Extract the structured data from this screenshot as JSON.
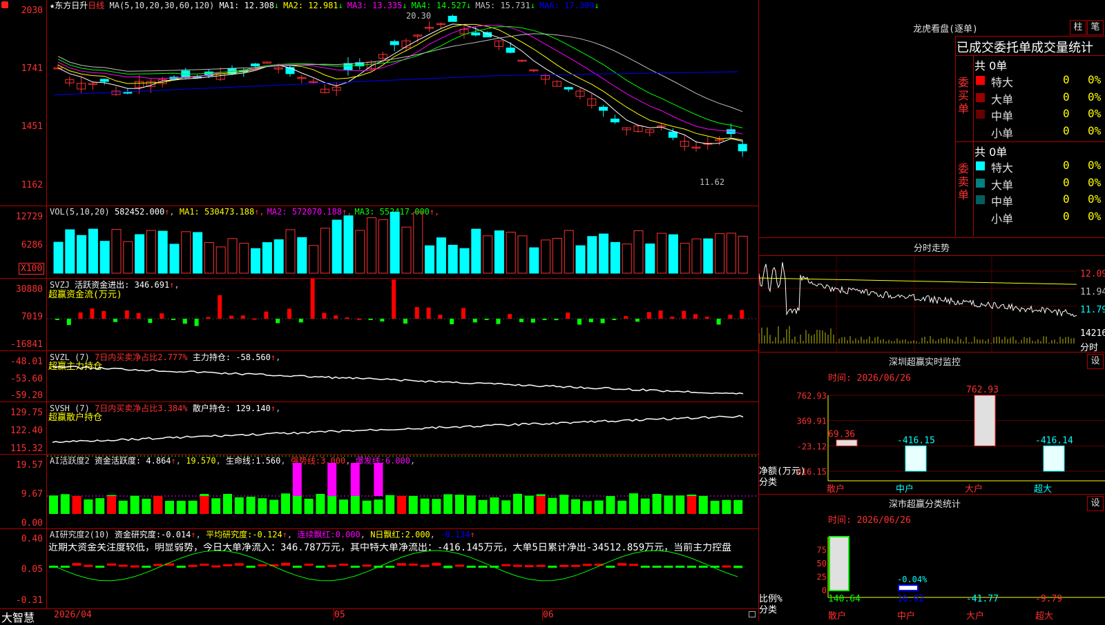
{
  "app_name": "大智慧",
  "chart": {
    "stock_name": "东方日升",
    "period": "日线",
    "ma_params": "MA(5,10,20,30,60,120)",
    "ma_values": [
      {
        "label": "MA1:",
        "value": "12.308",
        "arrow": "↓",
        "color": "#ffffff"
      },
      {
        "label": "MA2:",
        "value": "12.981",
        "arrow": "↓",
        "color": "#ffff00"
      },
      {
        "label": "MA3:",
        "value": "13.335",
        "arrow": "↓",
        "color": "#ff00ff"
      },
      {
        "label": "MA4:",
        "value": "14.527",
        "arrow": "↓",
        "color": "#00ff00"
      },
      {
        "label": "MA5:",
        "value": "15.731",
        "arrow": "↓",
        "color": "#c0c0c0"
      },
      {
        "label": "MA6:",
        "value": "17.309",
        "arrow": "↓",
        "color": "#0000ff"
      }
    ],
    "y_ticks": [
      "2030",
      "1741",
      "1451",
      "1162"
    ],
    "high_label": "20.30",
    "low_label": "11.62",
    "date_labels": [
      "2026/04",
      "05",
      "06"
    ]
  },
  "vol": {
    "title": "VOL(5,10,20)",
    "value": "582452.000",
    "arrow": "↑",
    "ma": [
      {
        "label": "MA1:",
        "value": "530473.188",
        "arrow": "↑",
        "color": "#ffff00"
      },
      {
        "label": "MA2:",
        "value": "572070.188",
        "arrow": "↑",
        "color": "#ff00ff"
      },
      {
        "label": "MA3:",
        "value": "552417.000",
        "arrow": "↑",
        "color": "#00ff00"
      }
    ],
    "y_ticks": [
      "12729",
      "6286"
    ],
    "unit": "X100"
  },
  "svzj": {
    "title": "SVZJ",
    "label": "活跃资金进出:",
    "value": "346.691",
    "arrow": "↑",
    "subtitle": "超赢资金流(万元)",
    "y_ticks": [
      "30880",
      "7019",
      "-16841"
    ]
  },
  "svzl": {
    "title": "SVZL (7)",
    "text1": "7日内买卖净占比2.777%",
    "text2": "主力持仓:",
    "value": "-58.560",
    "arrow": "↑",
    "subtitle": "超赢主力持仓",
    "y_ticks": [
      "-48.01",
      "-53.60",
      "-59.20"
    ]
  },
  "svsh": {
    "title": "SVSH (7)",
    "text1": "7日内买卖净占比3.384%",
    "text2": "散户持仓:",
    "value": "129.140",
    "arrow": "↑",
    "subtitle": "超赢散户持仓",
    "y_ticks": [
      "129.75",
      "122.40",
      "115.32"
    ]
  },
  "ai_activity": {
    "title": "AI活跃度2",
    "label1": "资金活跃度:",
    "value1": "4.864",
    "value2": "19.570",
    "label3": "生命线:",
    "value3": "1.560",
    "label4": "强势线:",
    "value4": "3.000",
    "label5": "爆发线:",
    "value5": "6.000",
    "y_ticks": [
      "19.57",
      "9.67",
      "0.00"
    ]
  },
  "ai_research": {
    "title": "AI研究度2(10)",
    "label1": "资金研究度:",
    "value1": "-0.014",
    "label2": "平均研究度:",
    "value2": "-0.124",
    "label3": "连续飘红:",
    "value3": "0.000",
    "label4": "N日飘红:",
    "value4": "2.000",
    "value5": "-0.134",
    "comment": "近期大资金关注度较低，明显弱势，今日大单净流入：346.787万元，其中特大单净流出：-416.145万元，大单5日累计净出-34512.859万元，当前主力控盘",
    "y_ticks": [
      "0.40",
      "0.05",
      "-0.31"
    ]
  },
  "longhu": {
    "title": "龙虎看盘(逐单)",
    "btn1": "柱",
    "btn2": "笔",
    "subtitle": "已成交委托单成交量统计",
    "buy_label": "委买单",
    "sell_label": "委卖单",
    "buy_total": "共 0单",
    "sell_total": "共 0单",
    "buy_rows": [
      {
        "name": "特大",
        "count": "0",
        "pct": "0%",
        "color": "#ff0000"
      },
      {
        "name": "大单",
        "count": "0",
        "pct": "0%",
        "color": "#990000"
      },
      {
        "name": "中单",
        "count": "0",
        "pct": "0%",
        "color": "#660000"
      },
      {
        "name": "小单",
        "count": "0",
        "pct": "0%",
        "color": "#000000"
      }
    ],
    "sell_rows": [
      {
        "name": "特大",
        "count": "0",
        "pct": "0%",
        "color": "#00ffff"
      },
      {
        "name": "大单",
        "count": "0",
        "pct": "0%",
        "color": "#008080"
      },
      {
        "name": "中单",
        "count": "0",
        "pct": "0%",
        "color": "#006060"
      },
      {
        "name": "小单",
        "count": "0",
        "pct": "0%",
        "color": "#000000"
      }
    ]
  },
  "timeshare": {
    "title": "分时走势",
    "y_ticks": [
      "12.09",
      "11.94",
      "11.79"
    ],
    "vol_label": "14216",
    "footer": "分时"
  },
  "monitor": {
    "title": "深圳超赢实时监控",
    "btn": "设",
    "time_label": "时间: 2026/06/26",
    "y_ticks": [
      "762.93",
      "369.91",
      "-23.12",
      "-416.15"
    ],
    "axis_label1": "净额(万元)",
    "axis_label2": "分类",
    "categories": [
      "散户",
      "中户",
      "大户",
      "超大"
    ],
    "values": [
      69.36,
      -416.15,
      762.93,
      -416.14
    ],
    "value_labels": [
      "69.36",
      "-416.15",
      "762.93",
      "-416.14"
    ]
  },
  "classify": {
    "title": "深市超赢分类统计",
    "btn": "设",
    "time_label": "时间: 2026/06/26",
    "y_ticks": [
      "75",
      "50",
      "25",
      "0"
    ],
    "axis_label1": "比例%",
    "axis_label2": "分类",
    "categories": [
      "散户",
      "中户",
      "大户",
      "超大"
    ],
    "bar_values": [
      100,
      10
    ],
    "bar_label": "-0.04%",
    "values": [
      "140.64",
      "10.92",
      "-41.77",
      "-9.79"
    ]
  }
}
